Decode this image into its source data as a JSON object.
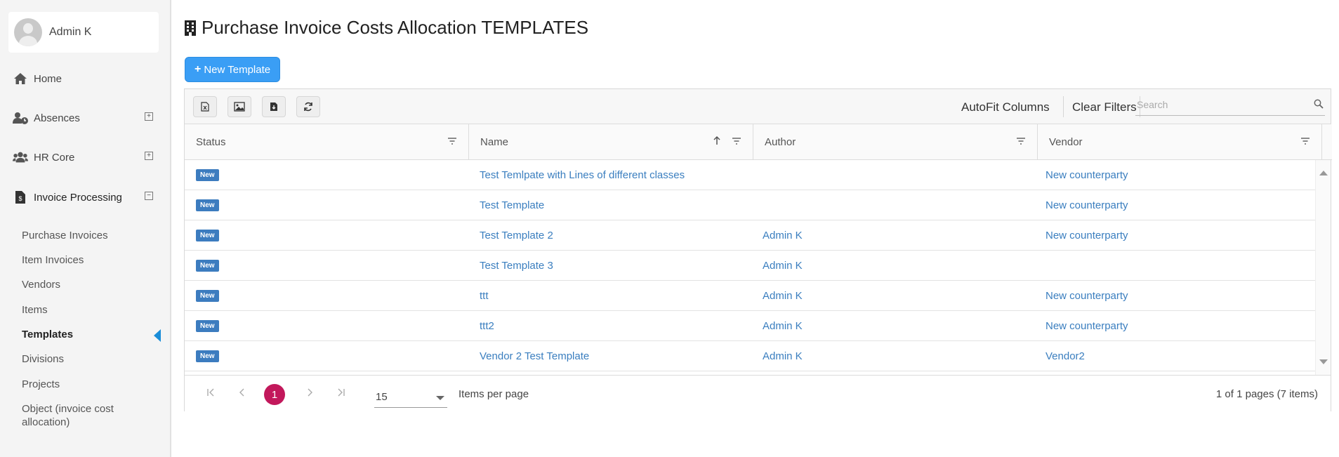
{
  "sidebar": {
    "user_name": "Admin K",
    "nav": {
      "home": "Home",
      "absences": "Absences",
      "hr_core": "HR Core",
      "invoice_processing": "Invoice Processing"
    },
    "sub_items": [
      "Purchase Invoices",
      "Item Invoices",
      "Vendors",
      "Items",
      "Templates",
      "Divisions",
      "Projects",
      "Object (invoice cost",
      "allocation)"
    ],
    "expand_plus": "⊞",
    "expand_minus": "⊟"
  },
  "page": {
    "title": "Purchase Invoice Costs Allocation TEMPLATES",
    "new_button": "New Template",
    "new_button_plus": "+"
  },
  "toolbar": {
    "autofit": "AutoFit Columns",
    "clear_filters": "Clear Filters",
    "search_placeholder": "Search"
  },
  "columns": [
    "Status",
    "Name",
    "Author",
    "Vendor"
  ],
  "rows": [
    {
      "status": "New",
      "name": "Test Temlpate with Lines of different classes",
      "author": "",
      "vendor": "New counterparty"
    },
    {
      "status": "New",
      "name": "Test Template",
      "author": "",
      "vendor": "New counterparty"
    },
    {
      "status": "New",
      "name": "Test Template 2",
      "author": "Admin K",
      "vendor": "New counterparty"
    },
    {
      "status": "New",
      "name": "Test Template 3",
      "author": "Admin K",
      "vendor": ""
    },
    {
      "status": "New",
      "name": "ttt",
      "author": "Admin K",
      "vendor": "New counterparty"
    },
    {
      "status": "New",
      "name": "ttt2",
      "author": "Admin K",
      "vendor": "New counterparty"
    },
    {
      "status": "New",
      "name": "Vendor 2 Test Template",
      "author": "Admin K",
      "vendor": "Vendor2"
    }
  ],
  "pager": {
    "current_page": "1",
    "page_size": "15",
    "items_per_page": "Items per page",
    "info": "1 of 1 pages (7 items)",
    "first": "|<",
    "prev": "<",
    "next": ">",
    "last": ">|"
  },
  "colors": {
    "accent": "#3a9ef5",
    "badge": "#3c7cbf",
    "link": "#3a7ebf",
    "page_active": "#c2185b",
    "active_marker": "#1a8dd8"
  }
}
